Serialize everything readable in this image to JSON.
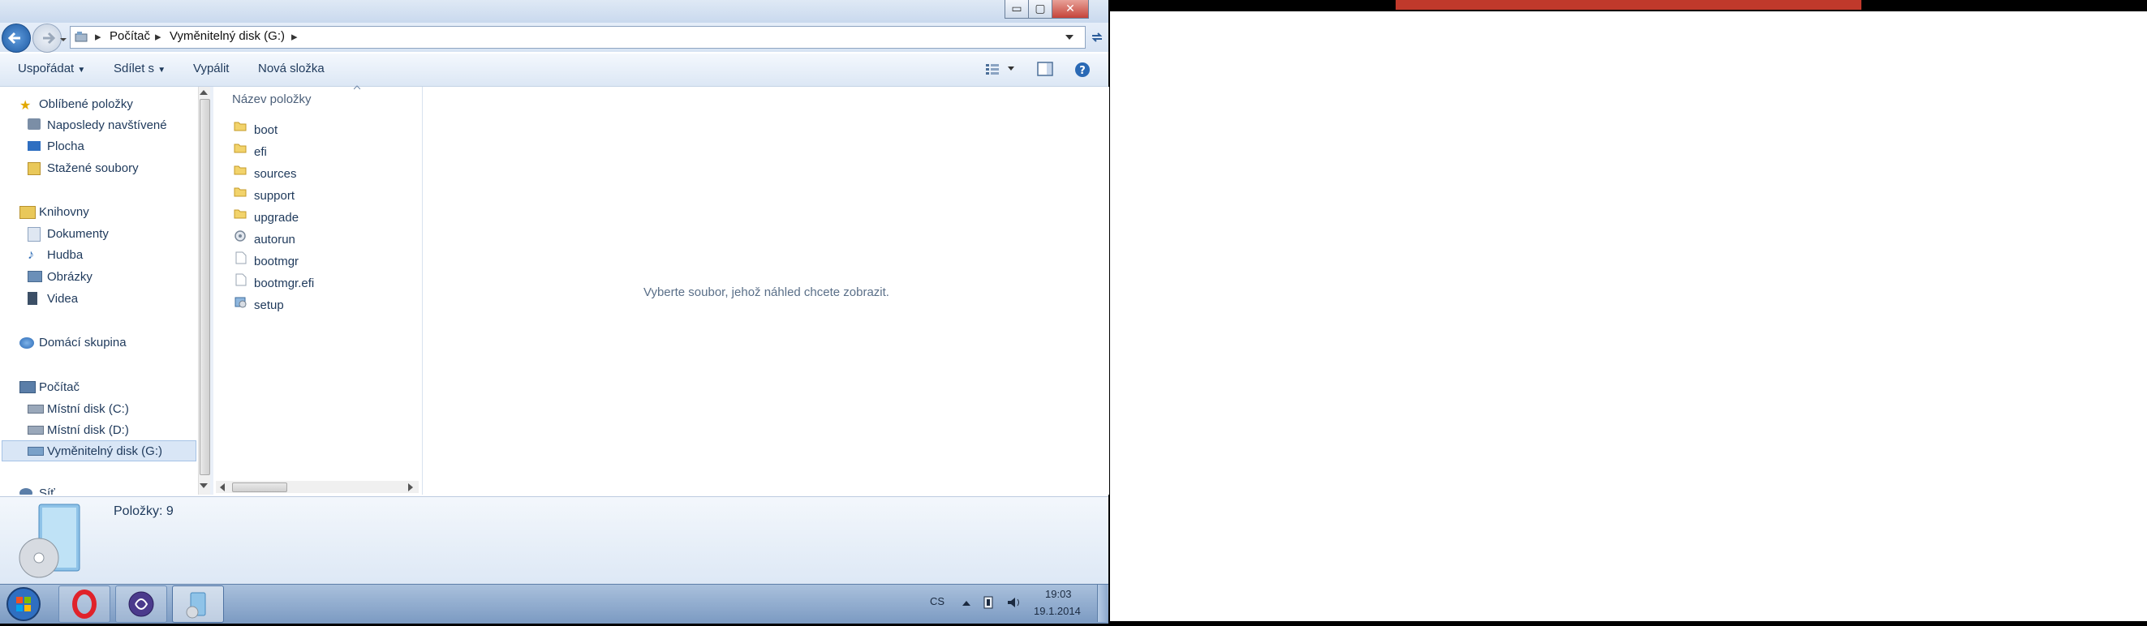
{
  "address": {
    "crumbs": [
      "Počítač",
      "Vyměnitelný disk (G:)"
    ]
  },
  "window_buttons": {
    "minimize": "▭",
    "maximize": "▢",
    "close": "✕"
  },
  "toolbar": {
    "organize": "Uspořádat",
    "share": "Sdílet s",
    "burn": "Vypálit",
    "new_folder": "Nová složka"
  },
  "nav": {
    "favorites": "Oblíbené položky",
    "recent": "Naposledy navštívené",
    "desktop": "Plocha",
    "downloads": "Stažené soubory",
    "libraries": "Knihovny",
    "documents": "Dokumenty",
    "music": "Hudba",
    "pictures": "Obrázky",
    "videos": "Videa",
    "homegroup": "Domácí skupina",
    "computer": "Počítač",
    "disk_c": "Místní disk (C:)",
    "disk_d": "Místní disk (D:)",
    "disk_g": "Vyměnitelný disk (G:)",
    "network": "Síť"
  },
  "files": {
    "column_header": "Název položky",
    "items": [
      "boot",
      "efi",
      "sources",
      "support",
      "upgrade",
      "autorun",
      "bootmgr",
      "bootmgr.efi",
      "setup"
    ]
  },
  "preview": {
    "message": "Vyberte soubor, jehož náhled chcete zobrazit."
  },
  "details": {
    "count": "Položky: 9"
  },
  "taskbar": {
    "lang": "CS",
    "time": "19:03",
    "date": "19.1.2014"
  },
  "colors": {
    "accent": "#1e395b",
    "taskbar": "#8fa9cc"
  }
}
